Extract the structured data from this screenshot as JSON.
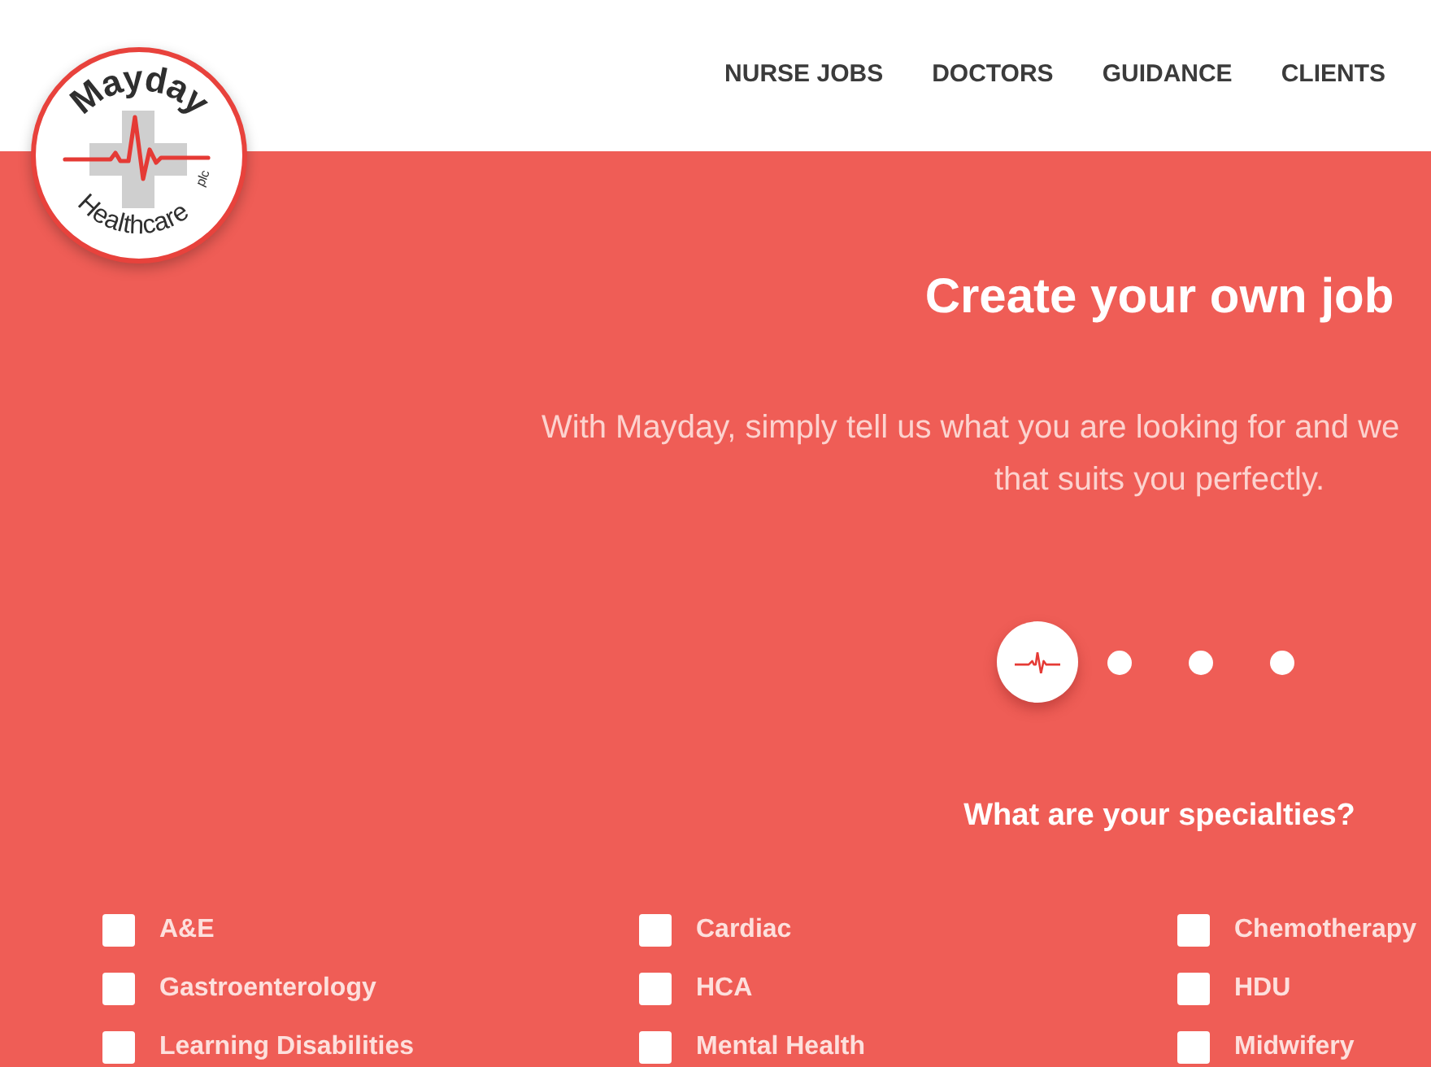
{
  "logo": {
    "name": "Mayday",
    "suffix": "plc",
    "subtitle": "Healthcare"
  },
  "nav": [
    {
      "label": "NURSE JOBS"
    },
    {
      "label": "DOCTORS"
    },
    {
      "label": "GUIDANCE"
    },
    {
      "label": "CLIENTS"
    }
  ],
  "hero": {
    "title": "Create your own job",
    "intro_lines": [
      "With Mayday, simply tell us what you are looking for and we",
      "that suits you perfectly."
    ]
  },
  "steps": [
    {
      "selected": true
    },
    {
      "selected": false
    },
    {
      "selected": false
    },
    {
      "selected": false
    }
  ],
  "specialties": {
    "title": "What are your specialties?",
    "options": [
      {
        "label": "A&E",
        "checked": false
      },
      {
        "label": "Cardiac",
        "checked": false
      },
      {
        "label": "Chemotherapy",
        "checked": false
      },
      {
        "label": "Gastroenterology",
        "checked": false
      },
      {
        "label": "HCA",
        "checked": false
      },
      {
        "label": "HDU",
        "checked": false
      },
      {
        "label": "Learning Disabilities",
        "checked": false
      },
      {
        "label": "Mental Health",
        "checked": false
      },
      {
        "label": "Midwifery",
        "checked": false
      }
    ]
  }
}
